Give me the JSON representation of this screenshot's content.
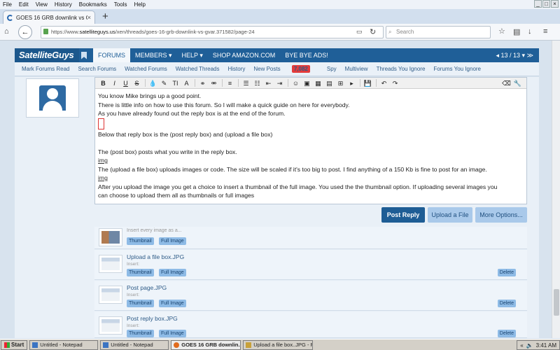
{
  "browser": {
    "menu": [
      "File",
      "Edit",
      "View",
      "History",
      "Bookmarks",
      "Tools",
      "Help"
    ],
    "tab_title": "GOES 16 GRB downlink vs GV...",
    "url_prefix": "https://www.",
    "url_host": "satelliteguys.us",
    "url_path": "/xen/threads/goes-16-grb-downlink-vs-gvar.371582/page-24",
    "search_placeholder": "Search"
  },
  "site": {
    "logo": "SatelliteGuys",
    "nav": [
      "FORUMS",
      "MEMBERS ▾",
      "HELP ▾",
      "SHOP AMAZON.COM",
      "BYE BYE ADS!"
    ],
    "pager": "◂ 13 / 13 ▾  ≫",
    "subnav": [
      "Mark Forums Read",
      "Search Forums",
      "Watched Forums",
      "Watched Threads",
      "History",
      "New Posts",
      "Spy",
      "Multiview",
      "Threads You Ignore",
      "Forums You Ignore"
    ],
    "new_posts_count": "7,082"
  },
  "editor": {
    "lines": [
      "You know Mike brings up a good point.",
      " There is little info on how to use this forum. So I will make a quick guide on here for everybody.",
      " As you have already found out the reply box is at the end of the forum."
    ],
    "line_after_cursor": " Below that reply box is the (post reply box) and (upload a file box)",
    "line_post_box": "The (post box) posts what you write in the reply box.",
    "img1": "img",
    "line_upload_box": "The (upload a file box) uploads images or code. The size will be scaled if it's too big to post. I find anything of a 150 Kb is fine to post for an image.",
    "img2": "img",
    "line_after_upload_1": " After you upload the image you get a choice to insert a thumbnail of the full image. You used the the thumbnail option. If uploading several images you",
    "line_after_upload_2": "can choose to upload them all as thumbnails or full images"
  },
  "buttons": {
    "post_reply": "Post Reply",
    "upload_file": "Upload a File",
    "more_options": "More Options..."
  },
  "attachments": {
    "insert_every": "Insert every image as a...",
    "insert_label": "Insert:",
    "thumbnail": "Thumbnail",
    "full_image": "Full Image",
    "delete": "Delete",
    "files": [
      "Upload a file box.JPG",
      "Post page.JPG",
      "Post reply box.JPG"
    ]
  },
  "taskbar": {
    "start": "Start",
    "items": [
      "Untitled - Notepad",
      "Untitled - Notepad",
      "GOES 16 GRB downlin...",
      "Upload a file box..JPG - P..."
    ],
    "clock": "3:41 AM"
  }
}
